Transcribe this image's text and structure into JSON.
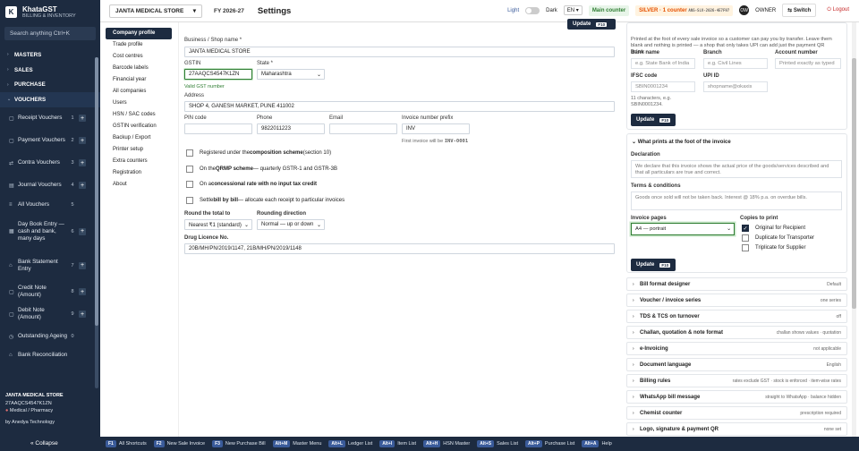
{
  "app": {
    "name": "KhataGST",
    "tagline": "BILLING & INVENTORY",
    "logo_letter": "K"
  },
  "sidebar": {
    "search_placeholder": "Search anything  Ctrl+K",
    "groups": [
      {
        "label": "MASTERS"
      },
      {
        "label": "SALES"
      },
      {
        "label": "PURCHASE"
      },
      {
        "label": "VOUCHERS"
      }
    ],
    "vouchers": [
      {
        "label": "Receipt Vouchers",
        "key": "1"
      },
      {
        "label": "Payment Vouchers",
        "key": "2"
      },
      {
        "label": "Contra Vouchers",
        "key": "3"
      },
      {
        "label": "Journal Vouchers",
        "key": "4"
      },
      {
        "label": "All Vouchers",
        "key": "5"
      },
      {
        "label": "Day Book Entry — cash and bank, many days",
        "key": "6"
      },
      {
        "label": "Bank Statement Entry",
        "key": "7"
      },
      {
        "label": "Credit Note (Amount)",
        "key": "8"
      },
      {
        "label": "Debit Note (Amount)",
        "key": "9"
      },
      {
        "label": "Outstanding Ageing",
        "key": "0"
      },
      {
        "label": "Bank Reconciliation",
        "key": ""
      }
    ],
    "shop_name": "JANTA MEDICAL STORE",
    "shop_gstin": "27AAQCS4547K1ZN",
    "shop_type": "Medical / Pharmacy",
    "footer_credit": "by Anedya Technology",
    "collapse_label": "« Collapse"
  },
  "topbar": {
    "shop": "JANTA MEDICAL STORE",
    "fy": "FY 2026-27",
    "page_title": "Settings",
    "theme_light": "Light",
    "theme_dark": "Dark",
    "lang": "EN",
    "counter": "Main counter",
    "plan": "SILVER · 1 counter",
    "license": "ANS-SLV-2026-4E7F97",
    "avatar_initials": "OW",
    "role": "OWNER",
    "switch_label": "Switch",
    "logout_label": "Logout"
  },
  "settings_nav": [
    "Company profile",
    "Trade profile",
    "Cost centres",
    "Barcode labels",
    "Financial year",
    "All companies",
    "Users",
    "HSN / SAC codes",
    "GSTIN verification",
    "Backup / Export",
    "Printer setup",
    "Extra counters",
    "Registration",
    "About"
  ],
  "form": {
    "business_name_label": "Business / Shop name *",
    "business_name": "JANTA MEDICAL STORE",
    "gstin_label": "GSTIN",
    "gstin": "27AAQCS4547K1ZN",
    "gstin_status": "Valid GST number",
    "state_label": "State *",
    "state": "Maharashtra",
    "address_label": "Address",
    "address": "SHOP 4, GANESH MARKET, PUNE 411002",
    "pin_label": "PIN code",
    "pin": "",
    "phone_label": "Phone",
    "phone": "9822011223",
    "email_label": "Email",
    "email": "",
    "prefix_label": "Invoice number prefix",
    "prefix": "INV",
    "prefix_hint": "First invoice will be",
    "prefix_example": "INV-0001",
    "checkboxes": [
      {
        "pre": "Registered under the ",
        "bold": "composition scheme",
        "post": " (section 10)"
      },
      {
        "pre": "On the ",
        "bold": "QRMP scheme",
        "post": " — quarterly GSTR-1 and GSTR-3B"
      },
      {
        "pre": "On a ",
        "bold": "concessional rate with no input tax credit",
        "post": ""
      },
      {
        "pre": "Settle ",
        "bold": "bill by bill",
        "post": " — allocate each receipt to particular invoices"
      }
    ],
    "round_label": "Round the total to",
    "round_value": "Nearest ₹1 (standard)",
    "rounding_dir_label": "Rounding direction",
    "rounding_dir_value": "Normal — up or down",
    "drug_label": "Drug Licence No.",
    "drug_value": "20B/MH/PN/2019/1147, 21B/MH/PN/2019/1148"
  },
  "right": {
    "top_btn": "Update",
    "top_btn_key": "F10",
    "upi_note": "Printed at the foot of every sale invoice so a customer can pay you by transfer. Leave them blank and nothing is printed — a shop that only takes UPI can add just the payment QR below.",
    "bank_label": "Bank name",
    "bank_ph": "e.g. State Bank of India",
    "branch_label": "Branch",
    "branch_ph": "e.g. Civil Lines",
    "acct_label": "Account number",
    "acct_ph": "Printed exactly as typed",
    "ifsc_label": "IFSC code",
    "ifsc_ph": "SBIN0001234",
    "upi_label": "UPI ID",
    "upi_ph": "shopname@okaxis",
    "ifsc_hint": "11 characters, e.g. SBIN0001234.",
    "update_label": "Update",
    "update_key": "F10",
    "foot_title": "What prints at the foot of the invoice",
    "decl_label": "Declaration",
    "decl_text": "We declare that this invoice shows the actual price of the goods/services described and that all particulars are true and correct.",
    "terms_label": "Terms & conditions",
    "terms_text": "Goods once sold will not be taken back. Interest @ 18% p.a. on overdue bills.",
    "pages_label": "Invoice pages",
    "pages_value": "A4 — portrait",
    "copies_label": "Copies to print",
    "copies": [
      {
        "label": "Original for Recipient",
        "checked": true
      },
      {
        "label": "Duplicate for Transporter",
        "checked": false
      },
      {
        "label": "Triplicate for Supplier",
        "checked": false
      }
    ],
    "sections": [
      {
        "title": "Bill format designer",
        "value": "Default"
      },
      {
        "title": "Voucher / invoice series",
        "value": "one series"
      },
      {
        "title": "TDS & TCS on turnover",
        "value": "off"
      },
      {
        "title": "Challan, quotation & note format",
        "value": "challan shows values · quotation"
      },
      {
        "title": "e-Invoicing",
        "value": "not applicable"
      },
      {
        "title": "Document language",
        "value": "English"
      },
      {
        "title": "Billing rules",
        "value": "rates exclude GST · stock is enforced · item-wise rates"
      },
      {
        "title": "WhatsApp bill message",
        "value": "straight to WhatsApp · balance hidden"
      },
      {
        "title": "Chemist counter",
        "value": "prescription required"
      },
      {
        "title": "Logo, signature & payment QR",
        "value": "none set"
      }
    ]
  },
  "shortcuts": [
    {
      "key": "F1",
      "label": "All Shortcuts"
    },
    {
      "key": "F2",
      "label": "New Sale Invoice"
    },
    {
      "key": "F3",
      "label": "New Purchase Bill"
    },
    {
      "key": "Alt+M",
      "label": "Master Menu"
    },
    {
      "key": "Alt+L",
      "label": "Ledger List"
    },
    {
      "key": "Alt+I",
      "label": "Item List"
    },
    {
      "key": "Alt+H",
      "label": "HSN Master"
    },
    {
      "key": "Alt+S",
      "label": "Sales List"
    },
    {
      "key": "Alt+P",
      "label": "Purchase List"
    },
    {
      "key": "Alt+A",
      "label": "Help"
    }
  ]
}
